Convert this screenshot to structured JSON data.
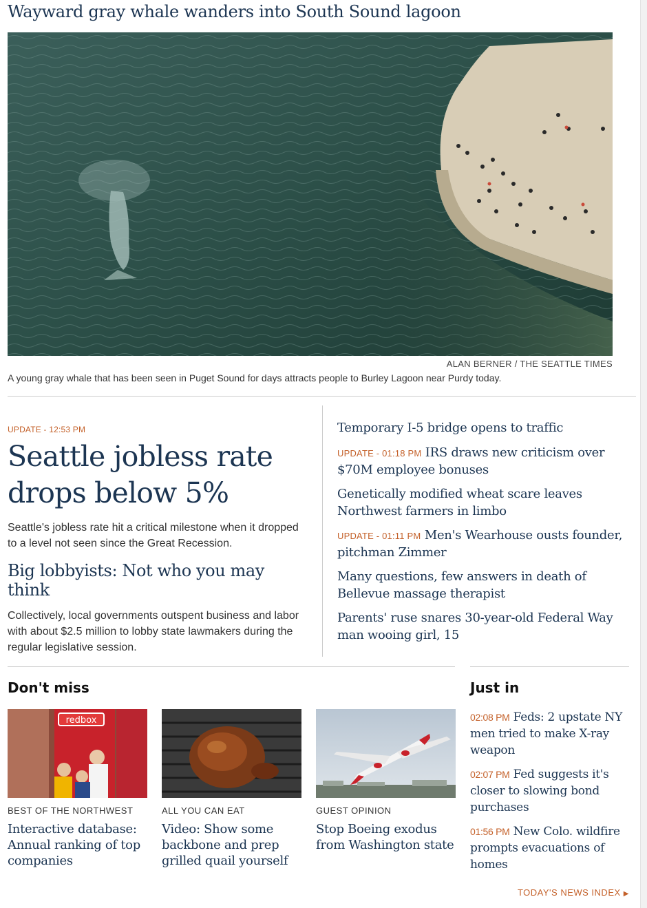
{
  "hero": {
    "title": "Wayward gray whale wanders into South Sound lagoon",
    "photo_desc_icon": "whale-lagoon-photo",
    "credit": "ALAN BERNER / THE SEATTLE TIMES",
    "caption": "A young gray whale that has been seen in Puget Sound for days attracts people to Burley Lagoon near Purdy today."
  },
  "lead": {
    "kicker": "UPDATE - 12:53 PM",
    "title": "Seattle jobless rate drops below 5%",
    "dek": "Seattle's jobless rate hit a critical milestone when it dropped to a level not seen since the Great Recession.",
    "second_title": "Big lobbyists: Not who you may think",
    "second_dek": "Collectively, local governments outspent business and labor with about $2.5 million to lobby state lawmakers during the regular legislative session."
  },
  "headlines": [
    {
      "stamp": "",
      "text": "Temporary I-5 bridge opens to traffic"
    },
    {
      "stamp": "UPDATE - 01:18 PM",
      "text": "IRS draws new criticism over $70M employee bonuses"
    },
    {
      "stamp": "",
      "text": "Genetically modified wheat scare leaves Northwest farmers in limbo"
    },
    {
      "stamp": "UPDATE - 01:11 PM",
      "text": "Men's Wearhouse ousts founder, pitchman Zimmer"
    },
    {
      "stamp": "",
      "text": "Many questions, few answers in death of Bellevue massage therapist"
    },
    {
      "stamp": "",
      "text": "Parents' ruse snares 30-year-old Federal Way man wooing girl, 15"
    }
  ],
  "dont_miss": {
    "title": "Don't miss",
    "cards": [
      {
        "category": "BEST OF THE NORTHWEST",
        "headline": "Interactive database: Annual ranking of top companies",
        "thumb_label": "redbox"
      },
      {
        "category": "ALL YOU CAN EAT",
        "headline": "Video: Show some backbone and prep grilled quail yourself"
      },
      {
        "category": "GUEST OPINION",
        "headline": "Stop Boeing exodus from Washington state"
      }
    ]
  },
  "just_in": {
    "title": "Just in",
    "items": [
      {
        "time": "02:08 PM",
        "text": "Feds: 2 upstate NY men tried to make X-ray weapon"
      },
      {
        "time": "02:07 PM",
        "text": "Fed suggests it's closer to slowing bond purchases"
      },
      {
        "time": "01:56 PM",
        "text": "New Colo. wildfire prompts evacuations of homes"
      }
    ]
  },
  "footer": {
    "news_index": "TODAY'S NEWS INDEX",
    "arrow": "▶"
  },
  "colors": {
    "headline": "#1c3552",
    "accent": "#c4612a",
    "rule": "#cccccc"
  }
}
